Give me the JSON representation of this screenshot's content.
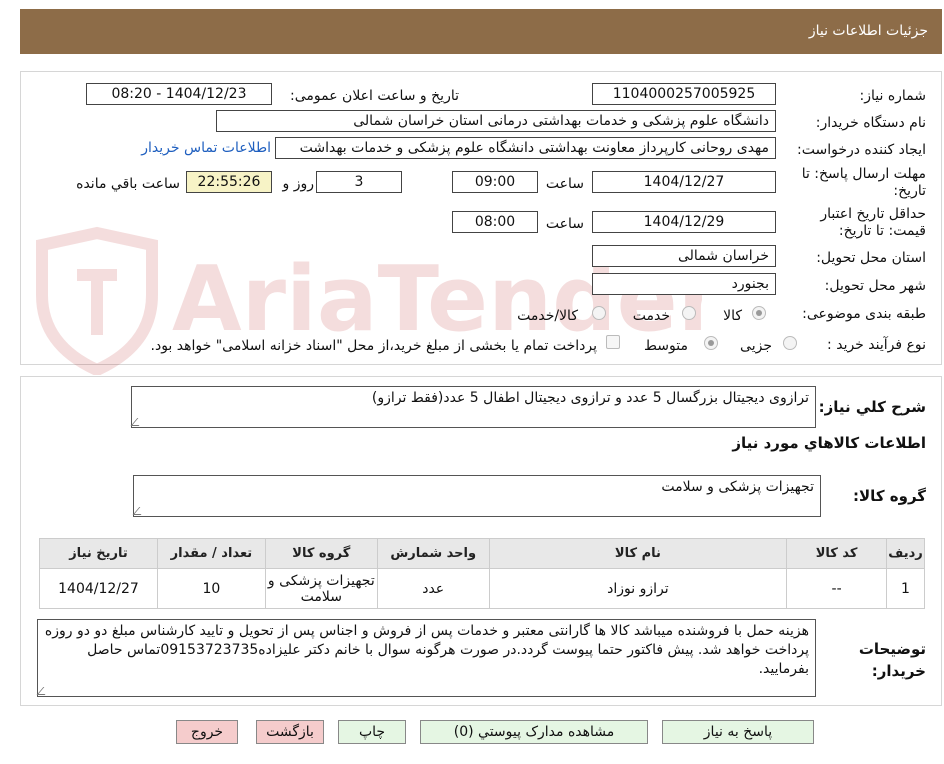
{
  "header": {
    "title": "جزئیات اطلاعات نیاز"
  },
  "watermark": {
    "text": "AriaTender.neT"
  },
  "form": {
    "need_number": {
      "label": "شماره نیاز:",
      "value": "1104000257005925"
    },
    "announce": {
      "label": "تاریخ و ساعت اعلان عمومی:",
      "value": "1404/12/23 - 08:20"
    },
    "buyer_org": {
      "label": "نام دستگاه خریدار:",
      "value": "دانشگاه علوم پزشکی و خدمات بهداشتی درمانی استان خراسان شمالی"
    },
    "requester": {
      "label": "ایجاد کننده درخواست:",
      "value": "مهدی روحانی کارپرداز معاونت بهداشتی دانشگاه علوم پزشکی و خدمات بهداشت",
      "contact_link": "اطلاعات تماس خریدار"
    },
    "deadline": {
      "label": "مهلت ارسال پاسخ: تا تاریخ:",
      "date": "1404/12/27",
      "time_label": "ساعت",
      "time": "09:00",
      "days": "3",
      "days_label": "روز و",
      "remaining": "22:55:26",
      "remaining_label": "ساعت باقي مانده"
    },
    "validity": {
      "label": "حداقل تاریخ اعتبار قیمت: تا تاریخ:",
      "date": "1404/12/29",
      "time_label": "ساعت",
      "time": "08:00"
    },
    "province": {
      "label": "استان محل تحویل:",
      "value": "خراسان شمالی"
    },
    "city": {
      "label": "شهر محل تحویل:",
      "value": "بجنورد"
    },
    "category": {
      "label": "طبقه بندی موضوعی:",
      "options": [
        "کالا",
        "خدمت",
        "کالا/خدمت"
      ],
      "selected": "کالا"
    },
    "process": {
      "label": "نوع فرآیند خرید :",
      "options": [
        "جزیی",
        "متوسط"
      ],
      "selected": "متوسط",
      "payment_note": "پرداخت تمام یا بخشی از مبلغ خرید،از محل \"اسناد خزانه اسلامی\" خواهد بود."
    }
  },
  "summary": {
    "label": "شرح کلي نیاز:",
    "value": "ترازوی دیجیتال بزرگسال 5 عدد و ترازوی دیجیتال اطفال 5 عدد(فقط ترازو)"
  },
  "goods_info": {
    "title": "اطلاعات کالاهاي مورد نیاز"
  },
  "goods_group": {
    "label": "گروه کالا:",
    "value": "تجهیزات پزشکی و سلامت"
  },
  "table": {
    "headers": [
      "ردیف",
      "کد کالا",
      "نام کالا",
      "واحد شمارش",
      "گروه کالا",
      "تعداد / مقدار",
      "تاریخ نیاز"
    ],
    "rows": [
      [
        "1",
        "--",
        "ترازو نوزاد",
        "عدد",
        "تجهیزات پزشکی و سلامت",
        "10",
        "1404/12/27"
      ]
    ]
  },
  "buyer_notes": {
    "label": "توضیحات خریدار:",
    "value": "هزینه حمل با فروشنده میباشد کالا ها گارانتی معتبر و خدمات پس از فروش و اجناس پس از تحویل و تایید کارشناس مبلغ دو دو روزه پرداخت خواهد شد. پیش فاکتور حتما پیوست گردد.در صورت هرگونه سوال با خانم دکتر علیزاده09153723735تماس حاصل بفرمایید."
  },
  "buttons": {
    "reply": "پاسخ به نیاز",
    "attachments": "مشاهده مدارک پیوستي (0)",
    "print": "چاپ",
    "back": "بازگشت",
    "exit": "خروج"
  }
}
